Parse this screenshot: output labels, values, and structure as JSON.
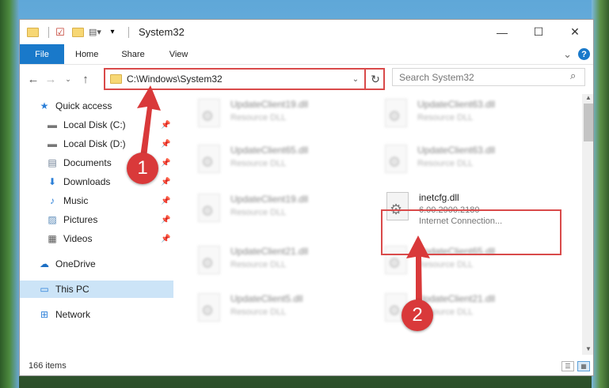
{
  "window": {
    "title": "System32",
    "controls": {
      "minimize": "—",
      "maximize": "☐",
      "close": "✕"
    }
  },
  "ribbon": {
    "tabs": [
      "File",
      "Home",
      "Share",
      "View"
    ],
    "expand_glyph": "⌄",
    "help_glyph": "?"
  },
  "address_bar": {
    "path": "C:\\Windows\\System32",
    "search_placeholder": "Search System32"
  },
  "nav": {
    "items": [
      {
        "label": "Quick access",
        "icon": "star-icon",
        "glyph": "★"
      },
      {
        "label": "Local Disk (C:)",
        "icon": "drive-icon",
        "glyph": "▬"
      },
      {
        "label": "Local Disk (D:)",
        "icon": "drive-icon",
        "glyph": "▬"
      },
      {
        "label": "Documents",
        "icon": "documents-icon",
        "glyph": "▤"
      },
      {
        "label": "Downloads",
        "icon": "download-icon",
        "glyph": "⬇"
      },
      {
        "label": "Music",
        "icon": "music-icon",
        "glyph": "♪"
      },
      {
        "label": "Pictures",
        "icon": "pictures-icon",
        "glyph": "▨"
      },
      {
        "label": "Videos",
        "icon": "videos-icon",
        "glyph": "▦"
      },
      {
        "label": "OneDrive",
        "icon": "cloud-icon",
        "glyph": "☁"
      },
      {
        "label": "This PC",
        "icon": "computer-icon",
        "glyph": "▭"
      },
      {
        "label": "Network",
        "icon": "network-icon",
        "glyph": "⊞"
      }
    ]
  },
  "files": [
    {
      "name": "UpdateClient19.dll",
      "sub": "Resource DLL"
    },
    {
      "name": "UpdateClient63.dll",
      "sub": "Resource DLL"
    },
    {
      "name": "UpdateClient65.dll",
      "sub": "Resource DLL"
    },
    {
      "name": "UpdateClient63.dll",
      "sub": "Resource DLL"
    },
    {
      "name": "UpdateClient19.dll",
      "sub": "Resource DLL"
    },
    {
      "name": "inetcfg.dll",
      "sub": "6.00.2900.2180",
      "sub2": "Internet Connection..."
    },
    {
      "name": "UpdateClient21.dll",
      "sub": "Resource DLL"
    },
    {
      "name": "UpdateClient65.dll",
      "sub": "Resource DLL"
    },
    {
      "name": "UpdateClient5.dll",
      "sub": "Resource DLL"
    },
    {
      "name": "UpdateClient21.dll",
      "sub": "Resource DLL"
    }
  ],
  "status": {
    "count": "166 items"
  },
  "annotations": {
    "marker1": "1",
    "marker2": "2",
    "color": "#d9393a"
  }
}
